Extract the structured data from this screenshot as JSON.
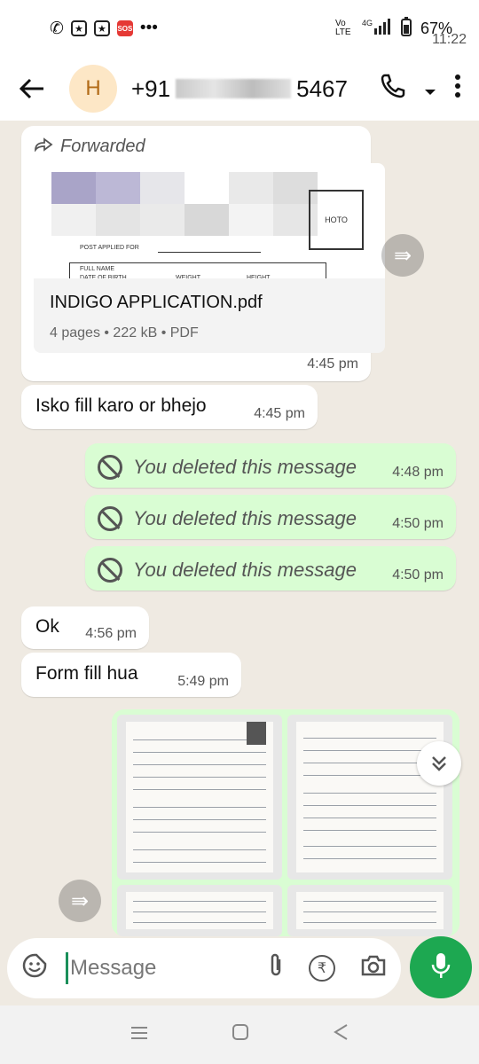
{
  "status": {
    "time": "11:22",
    "battery": "67%",
    "network": "4G",
    "volte": "Vo LTE",
    "sos": "SOS",
    "more": "•••"
  },
  "header": {
    "avatar_letter": "H",
    "phone_prefix": "+91",
    "phone_suffix": "5467"
  },
  "messages": {
    "forwarded_label": "Forwarded",
    "pdf": {
      "name": "INDIGO APPLICATION.pdf",
      "meta": "4 pages • 222 kB • PDF",
      "time": "4:45 pm",
      "form_post": "POST APPLIED FOR",
      "form_name": "FULL NAME",
      "form_dob": "DATE OF BIRTH",
      "form_weight": "WEIGHT",
      "form_height": "HEIGHT",
      "form_photo": "HOTO"
    },
    "m1": {
      "text": "Isko fill karo or bhejo",
      "time": "4:45 pm"
    },
    "deleted": [
      {
        "text": "You deleted this message",
        "time": "4:48 pm"
      },
      {
        "text": "You deleted this message",
        "time": "4:50 pm"
      },
      {
        "text": "You deleted this message",
        "time": "4:50 pm"
      }
    ],
    "m2": {
      "text": "Ok",
      "time": "4:56 pm"
    },
    "m3": {
      "text": "Form fill hua",
      "time": "5:49 pm"
    }
  },
  "composer": {
    "placeholder": "Message"
  },
  "colors": {
    "accent": "#1da851",
    "outgoing": "#d9fdd3",
    "background": "#efeae2"
  }
}
